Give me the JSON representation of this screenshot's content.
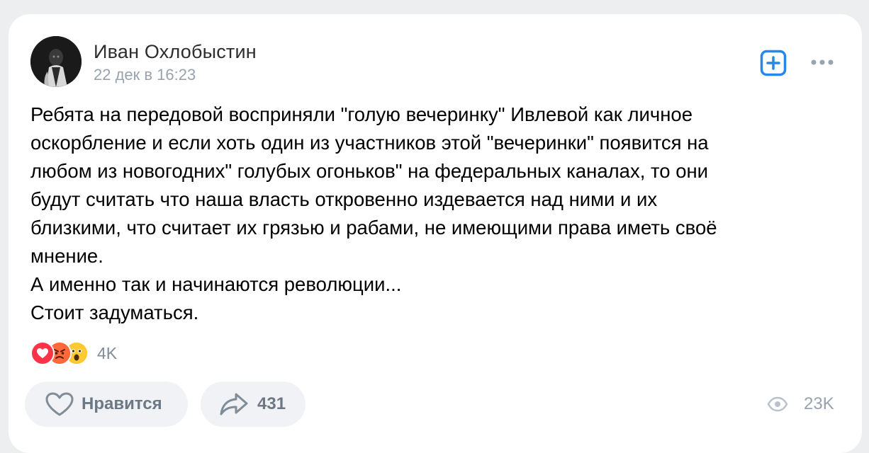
{
  "post": {
    "author": "Иван Охлобыстин",
    "date": "22 дек в 16:23",
    "text": "Ребята на передовой восприняли \"голую вечеринку\" Ивлевой как личное\nоскорбление и если хоть один из участников этой \"вечеринки\" появится на\nлюбом из новогодних\" голубых огоньков\" на федеральных каналах, то они\nбудут считать что наша власть откровенно издевается над ними и их\nблизкими, что считает их грязью и рабами, не имеющими права иметь своё\nмнение.\nА именно так и начинаются революции...\nСтоит задуматься."
  },
  "reactions": {
    "icons": [
      "heart-reaction",
      "angry-reaction",
      "surprised-reaction"
    ],
    "count": "4K"
  },
  "actions": {
    "like_label": "Нравится",
    "share_count": "431"
  },
  "views": {
    "count": "23K"
  },
  "colors": {
    "accent": "#2688eb",
    "background": "#edeef0",
    "card": "#ffffff",
    "secondary_text": "#99a2ad",
    "button_bg": "#f0f2f5"
  }
}
